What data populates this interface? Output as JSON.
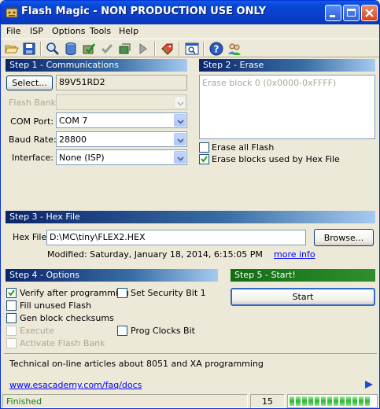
{
  "window": {
    "title": "Flash Magic - NON PRODUCTION USE ONLY"
  },
  "menu": [
    "File",
    "ISP",
    "Options",
    "Tools",
    "Help"
  ],
  "toolbar_icons": [
    "open-icon",
    "save-icon",
    "find-icon",
    "database-icon",
    "program-icon",
    "check-icon",
    "blank-check-icon",
    "go-icon",
    "tag-icon",
    "view-icon",
    "help-icon",
    "users-icon"
  ],
  "step1": {
    "title": "Step 1 - Communications",
    "select_label": "Select...",
    "device": "89V51RD2",
    "flash_bank_label": "Flash Bank:",
    "flash_bank_value": "",
    "com_port_label": "COM Port:",
    "com_port_value": "COM 7",
    "baud_label": "Baud Rate:",
    "baud_value": "28800",
    "interface_label": "Interface:",
    "interface_value": "None (ISP)"
  },
  "step2": {
    "title": "Step 2 - Erase",
    "blocks": [
      "Erase block 0 (0x0000-0xFFFF)"
    ],
    "erase_all_label": "Erase all Flash",
    "erase_all_checked": false,
    "erase_used_label": "Erase blocks used by Hex File",
    "erase_used_checked": true
  },
  "step3": {
    "title": "Step 3 - Hex File",
    "hex_label": "Hex File:",
    "hex_path": "D:\\MC\\tiny\\FLEX2.HEX",
    "browse_label": "Browse...",
    "modified": "Modified: Saturday, January 18, 2014, 6:15:05 PM",
    "more_info": "more info"
  },
  "step4": {
    "title": "Step 4 - Options",
    "verify_label": "Verify after programming",
    "verify_checked": true,
    "fill_label": "Fill unused Flash",
    "gen_label": "Gen block checksums",
    "execute_label": "Execute",
    "activate_label": "Activate Flash Bank",
    "security_label": "Set Security Bit 1",
    "prog_clocks_label": "Prog Clocks Bit"
  },
  "step5": {
    "title": "Step 5 - Start!",
    "start_label": "Start"
  },
  "info": {
    "text": "Technical on-line articles about 8051 and XA programming",
    "link": "www.esacademy.com/faq/docs"
  },
  "status": {
    "text": "Finished",
    "count": "15",
    "progress": 1.0
  }
}
